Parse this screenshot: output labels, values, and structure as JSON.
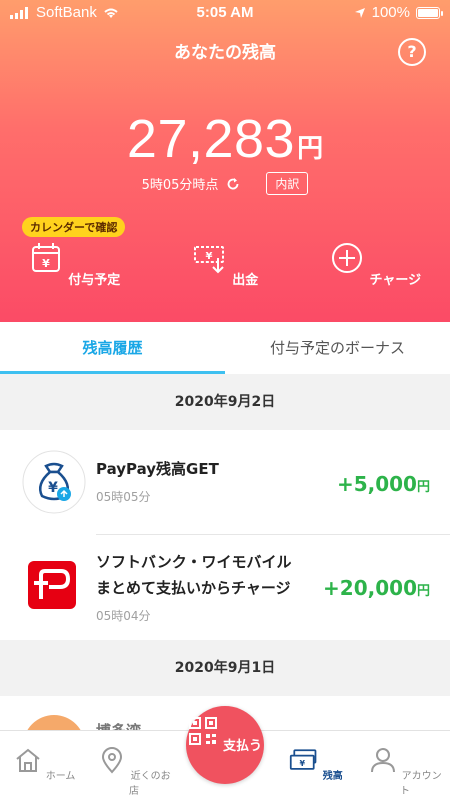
{
  "status_bar": {
    "carrier": "SoftBank",
    "time": "5:05 AM",
    "battery": "100%"
  },
  "header": {
    "title": "あなたの残高",
    "help_label": "?",
    "balance_value": "27,283",
    "balance_unit": "円",
    "as_of": "5時05分時点",
    "breakdown_label": "内訳",
    "calendar_badge": "カレンダーで確認",
    "actions": [
      {
        "label": "付与予定",
        "icon": "calendar-icon"
      },
      {
        "label": "出金",
        "icon": "withdraw-icon"
      },
      {
        "label": "チャージ",
        "icon": "plus-circle-icon"
      }
    ]
  },
  "tabs": [
    {
      "label": "残高履歴",
      "active": true
    },
    {
      "label": "付与予定のボーナス",
      "active": false
    }
  ],
  "history": [
    {
      "date": "2020年9月2日",
      "items": [
        {
          "name": "PayPay残高GET",
          "time": "05時05分",
          "amount": "+5,000",
          "unit": "円",
          "icon": "money-bag-icon"
        },
        {
          "name_line1": "ソフトバンク・ワイモバイル",
          "name_line2": "まとめて支払いからチャージ",
          "time": "05時04分",
          "amount": "+20,000",
          "unit": "円",
          "icon": "paypay-logo-icon"
        }
      ]
    },
    {
      "date": "2020年9月1日",
      "items": [
        {
          "name": "博多湾…",
          "icon": "merchant-icon"
        }
      ]
    }
  ],
  "bottom_nav": [
    {
      "label": "ホーム",
      "icon": "home-icon"
    },
    {
      "label": "近くのお店",
      "icon": "map-pin-icon"
    },
    {
      "label": "支払う",
      "icon": "qr-code-icon"
    },
    {
      "label": "残高",
      "icon": "wallet-icon",
      "active": true
    },
    {
      "label": "アカウント",
      "icon": "person-icon"
    }
  ],
  "colors": {
    "accent_blue": "#1aa7e6",
    "positive_green": "#2db34a",
    "pay_red": "#f0525f"
  }
}
